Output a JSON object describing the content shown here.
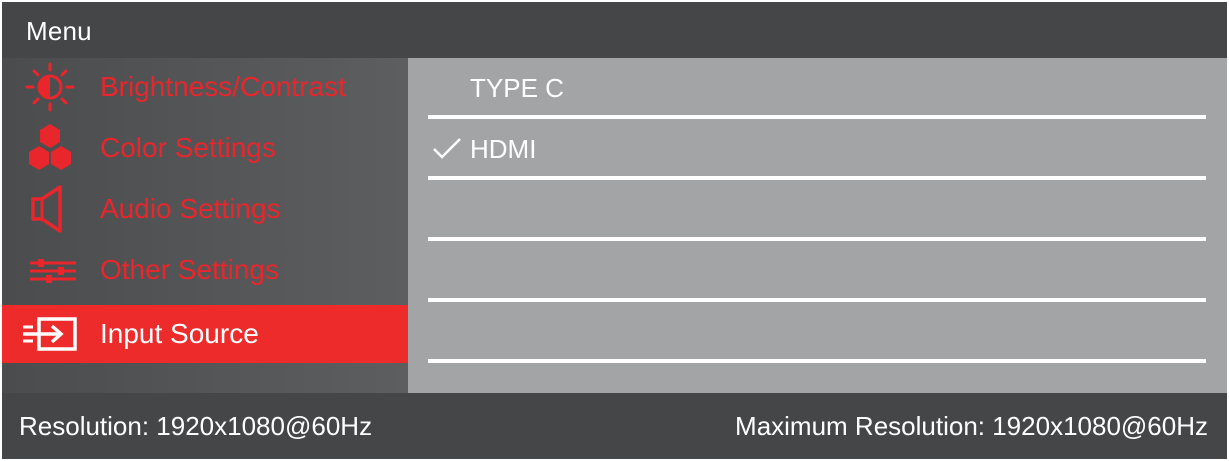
{
  "title": "Menu",
  "colors": {
    "accent": "#ee2b2b",
    "inactive_label": "#e8262b",
    "panel": "#a3a4a6",
    "bar": "#454648"
  },
  "sidebar": {
    "items": [
      {
        "label": "Brightness/Contrast",
        "icon": "brightness-icon",
        "selected": false
      },
      {
        "label": "Color Settings",
        "icon": "color-settings-icon",
        "selected": false
      },
      {
        "label": "Audio Settings",
        "icon": "speaker-icon",
        "selected": false
      },
      {
        "label": "Other Settings",
        "icon": "sliders-icon",
        "selected": false
      },
      {
        "label": "Input Source",
        "icon": "input-source-icon",
        "selected": true
      }
    ]
  },
  "options": [
    {
      "label": "TYPE C",
      "checked": false
    },
    {
      "label": "HDMI",
      "checked": true
    },
    {
      "label": "",
      "checked": false
    },
    {
      "label": "",
      "checked": false
    },
    {
      "label": "",
      "checked": false
    }
  ],
  "footer": {
    "resolution": "Resolution: 1920x1080@60Hz",
    "max_resolution": "Maximum Resolution: 1920x1080@60Hz"
  }
}
